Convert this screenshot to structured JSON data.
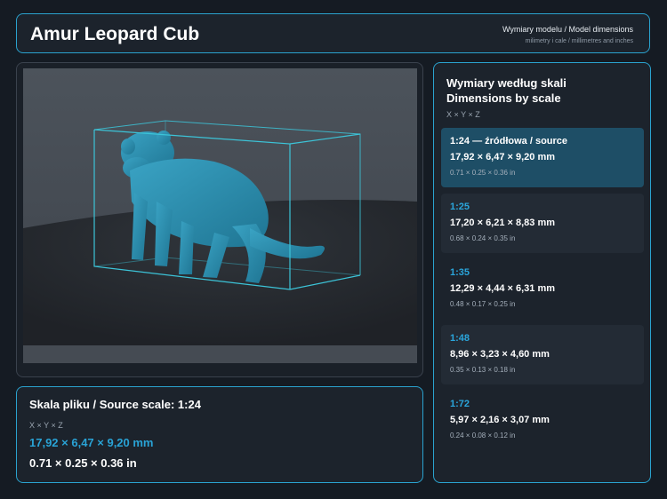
{
  "header": {
    "title": "Amur Leopard Cub",
    "subtitle": "Wymiary modelu / Model dimensions",
    "caption": "milimetry i cale / millimetres and inches"
  },
  "viewer": {
    "model_name": "amur-leopard-cub-model",
    "colors": {
      "model": "#2a8fb0",
      "bbox": "#3cc4d8",
      "backdrop": "#495058",
      "floor": "#25292e"
    }
  },
  "source": {
    "heading": "Skala pliku / Source scale: 1:24",
    "axes": "X × Y × Z",
    "mm": "17,92 × 6,47 × 9,20 mm",
    "inches": "0.71 × 0.25 × 0.36 in"
  },
  "scales": {
    "heading_pl": "Wymiary według skali",
    "heading_en": "Dimensions by scale",
    "axes": "X × Y × Z",
    "items": [
      {
        "label": "1:24  —  źródłowa / source",
        "mm": "17,92 × 6,47 × 9,20 mm",
        "inches": "0.71 × 0.25 × 0.36 in"
      },
      {
        "label": "1:25",
        "mm": "17,20 × 6,21 × 8,83 mm",
        "inches": "0.68 × 0.24 × 0.35 in"
      },
      {
        "label": "1:35",
        "mm": "12,29 × 4,44 × 6,31 mm",
        "inches": "0.48 × 0.17 × 0.25 in"
      },
      {
        "label": "1:48",
        "mm": "8,96 × 3,23 × 4,60 mm",
        "inches": "0.35 × 0.13 × 0.18 in"
      },
      {
        "label": "1:72",
        "mm": "5,97 × 2,16 × 3,07 mm",
        "inches": "0.24 × 0.08 × 0.12 in"
      }
    ]
  },
  "accent_color": "#2aa3cf"
}
